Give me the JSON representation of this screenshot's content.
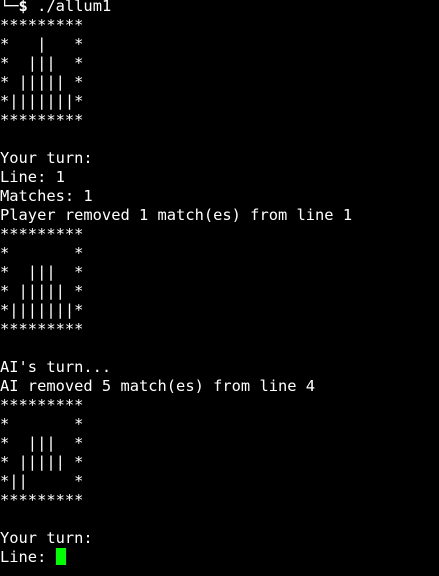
{
  "terminal": {
    "prompt_prefix": "└─",
    "prompt_symbol": "$",
    "command": " ./allum1",
    "cursor_color": "#00ff00",
    "background": "#000000",
    "foreground": "#ffffff"
  },
  "lines": [
    "*********",
    "*   |   *",
    "*  |||  *",
    "* ||||| *",
    "*|||||||*",
    "*********",
    "",
    "Your turn:",
    "Line: 1",
    "Matches: 1",
    "Player removed 1 match(es) from line 1",
    "*********",
    "*       *",
    "*  |||  *",
    "* ||||| *",
    "*|||||||*",
    "*********",
    "",
    "AI's turn...",
    "AI removed 5 match(es) from line 4",
    "*********",
    "*       *",
    "*  |||  *",
    "* ||||| *",
    "*||     *",
    "*********",
    "",
    "Your turn:"
  ],
  "input_line": {
    "label": "Line: "
  }
}
